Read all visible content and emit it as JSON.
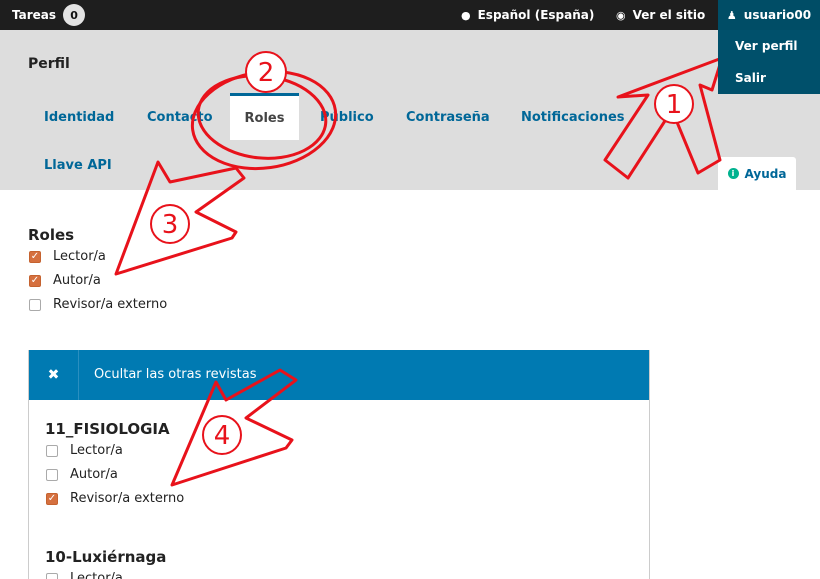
{
  "topbar": {
    "tasks_label": "Tareas",
    "tasks_count": "0",
    "language_label": "Español (España)",
    "view_site_label": "Ver el sitio",
    "user_label": "usuario00"
  },
  "user_menu": {
    "items": [
      "Ver perfil",
      "Salir"
    ]
  },
  "header": {
    "title": "Perfil",
    "tabs": [
      "Identidad",
      "Contacto",
      "Roles",
      "Público",
      "Contraseña",
      "Notificaciones",
      "Llave API"
    ],
    "active_tab": "Roles",
    "help_label": "Ayuda"
  },
  "roles": {
    "title": "Roles",
    "options": [
      {
        "label": "Lector/a",
        "checked": true
      },
      {
        "label": "Autor/a",
        "checked": true
      },
      {
        "label": "Revisor/a externo",
        "checked": false
      }
    ]
  },
  "other_journals": {
    "toggle_label": "Ocultar las otras revistas",
    "journals": [
      {
        "name": "11_FISIOLOGIA",
        "options": [
          {
            "label": "Lector/a",
            "checked": false
          },
          {
            "label": "Autor/a",
            "checked": false
          },
          {
            "label": "Revisor/a externo",
            "checked": true
          }
        ]
      },
      {
        "name": "10-Luxiérnaga",
        "options": [
          {
            "label": "Lector/a",
            "checked": false
          }
        ]
      }
    ]
  },
  "annotations": {
    "step_labels": [
      "1",
      "2",
      "3",
      "4"
    ],
    "color": "#e8121b"
  }
}
